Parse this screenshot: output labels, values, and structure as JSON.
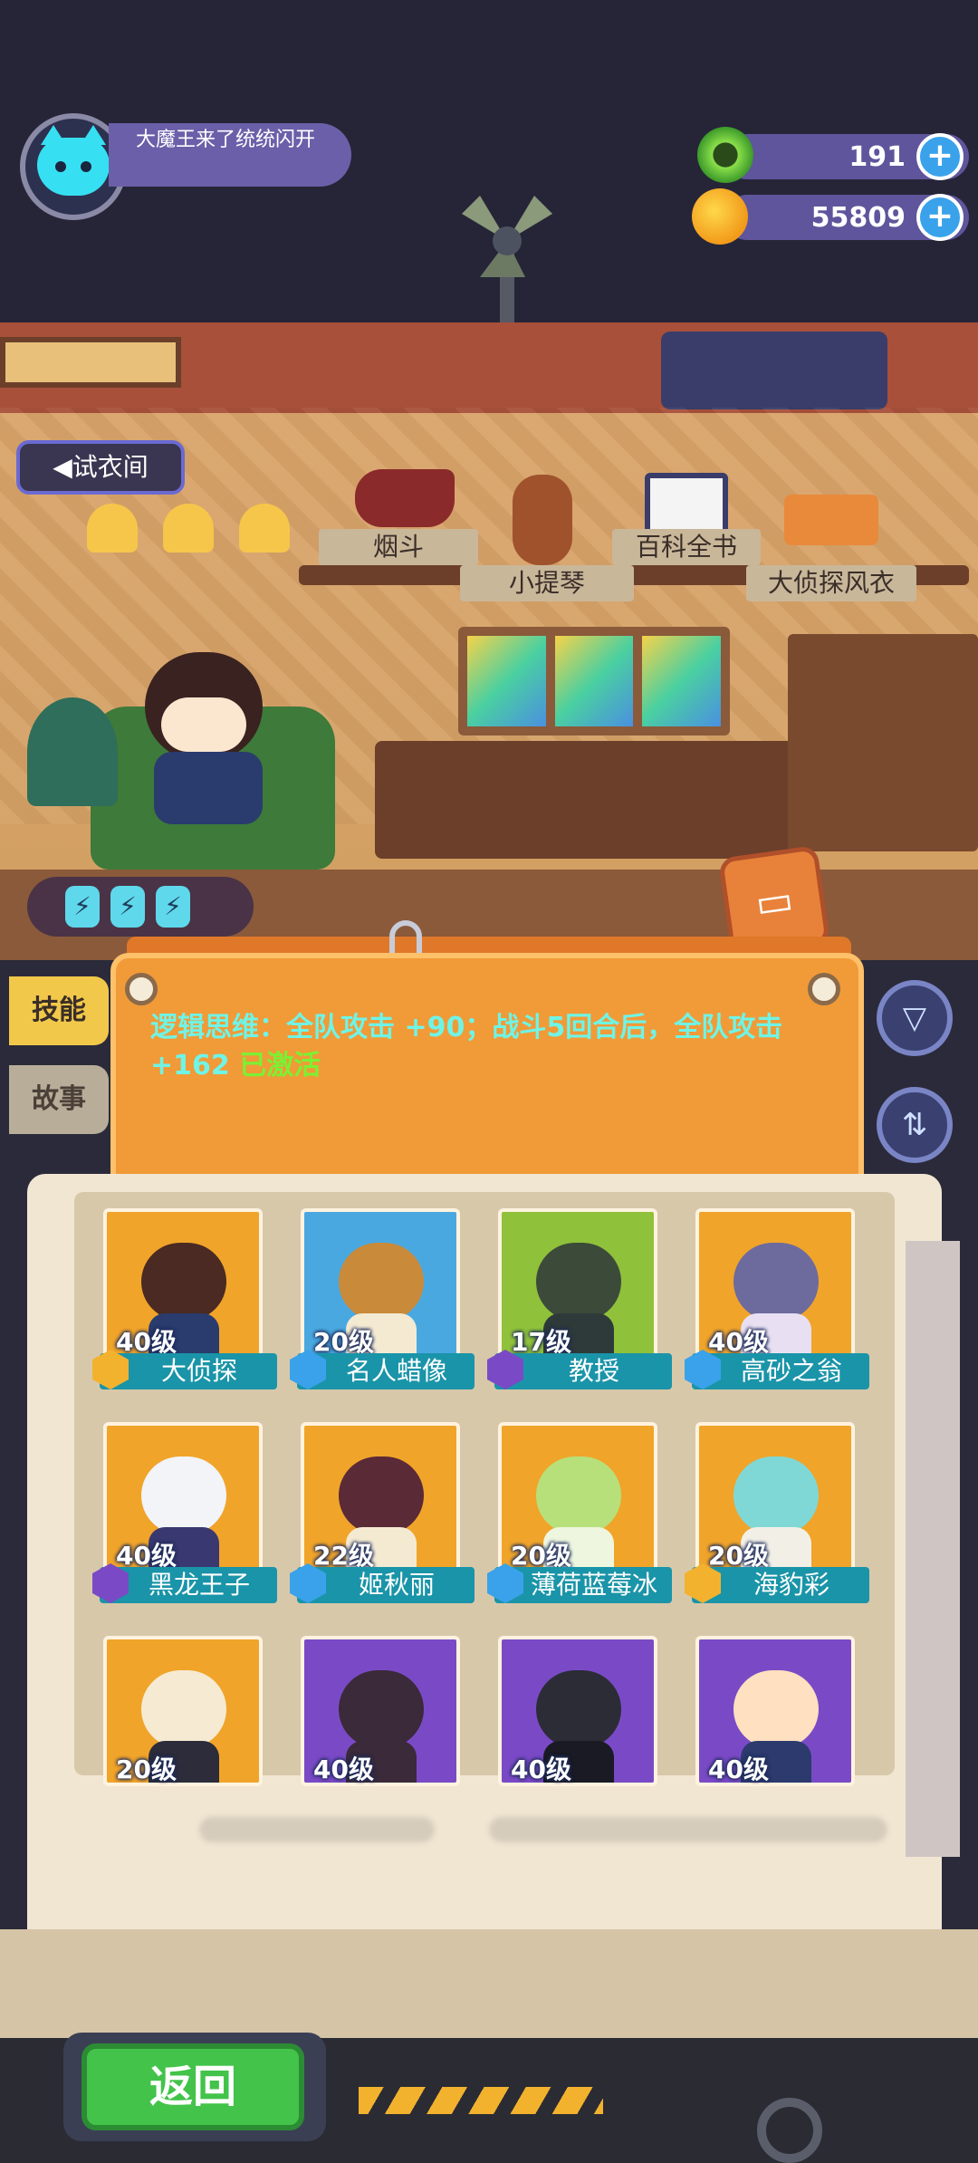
{
  "header": {
    "player_name": "大魔王来了统统闪开",
    "currencies": [
      {
        "icon": "green-gem-icon",
        "value": "191"
      },
      {
        "icon": "gold-coin-icon",
        "value": "55809"
      }
    ]
  },
  "scene": {
    "fitting_room": "试衣间",
    "items": [
      "烟斗",
      "小提琴",
      "百科全书",
      "大侦探风衣"
    ],
    "energy": [
      "⚡",
      "⚡",
      "⚡"
    ]
  },
  "skill_panel": {
    "text_main": "逻辑思维：全队攻击 +90；战斗5回合后，全队攻击 +162",
    "text_status": "已激活"
  },
  "tabs": {
    "skill": "技能",
    "story": "故事"
  },
  "characters": [
    {
      "level": "40级",
      "name": "大侦探",
      "bg": "#f0a42a",
      "head": "#4a2a22",
      "body": "#2a3b6e",
      "badge": "#f2b22e"
    },
    {
      "level": "20级",
      "name": "名人蜡像",
      "bg": "#4aa8e0",
      "head": "#c98a3a",
      "body": "#f4ead2",
      "badge": "#3aa2ea"
    },
    {
      "level": "17级",
      "name": "教授",
      "bg": "#8fc13a",
      "head": "#3c4a3a",
      "body": "#2e3a3a",
      "badge": "#7a4ac6"
    },
    {
      "level": "40级",
      "name": "高砂之翁",
      "bg": "#f0a42a",
      "head": "#6d6a9e",
      "body": "#e8e0f2",
      "badge": "#3aa2ea"
    },
    {
      "level": "40级",
      "name": "黑龙王子",
      "bg": "#f0a42a",
      "head": "#f2f4f8",
      "body": "#3a3870",
      "badge": "#7a4ac6"
    },
    {
      "level": "22级",
      "name": "姬秋丽",
      "bg": "#f0a42a",
      "head": "#5a2a36",
      "body": "#f4ead2",
      "badge": "#3aa2ea"
    },
    {
      "level": "20级",
      "name": "薄荷蓝莓冰",
      "bg": "#f0a42a",
      "head": "#b8e07a",
      "body": "#eef6e0",
      "badge": "#3aa2ea"
    },
    {
      "level": "20级",
      "name": "海豹彩",
      "bg": "#f0a42a",
      "head": "#7fd8d6",
      "body": "#f2f0e6",
      "badge": "#f2b22e"
    },
    {
      "level": "20级",
      "name": "",
      "bg": "#f0a42a",
      "head": "#f6ead2",
      "body": "#2c2c3a",
      "badge": ""
    },
    {
      "level": "40级",
      "name": "",
      "bg": "#7a4ac6",
      "head": "#3a2a3a",
      "body": "#3a2a3a",
      "badge": ""
    },
    {
      "level": "40级",
      "name": "",
      "bg": "#7a4ac6",
      "head": "#2c2c36",
      "body": "#1a1a24",
      "badge": ""
    },
    {
      "level": "40级",
      "name": "",
      "bg": "#7a4ac6",
      "head": "#ffe0c0",
      "body": "#2c3a6e",
      "badge": ""
    }
  ],
  "footer": {
    "back_label": "返回"
  }
}
